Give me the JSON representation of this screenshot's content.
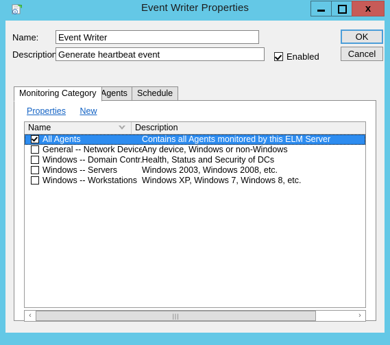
{
  "window": {
    "title": "Event Writer Properties",
    "icon": "event-writer-icon",
    "minimize_label": "—",
    "maximize_label": "□",
    "close_label": "x"
  },
  "form": {
    "name_label": "Name:",
    "name_value": "Event Writer",
    "name_placeholder": "",
    "description_label": "Description",
    "description_value": "Generate heartbeat event",
    "description_placeholder": "",
    "enabled_label": "Enabled",
    "enabled_checked": true
  },
  "buttons": {
    "ok_label": "OK",
    "cancel_label": "Cancel"
  },
  "tabs": [
    {
      "label": "Monitoring Category",
      "active": true
    },
    {
      "label": "Agents",
      "active": false
    },
    {
      "label": "Schedule",
      "active": false
    }
  ],
  "toolbar_links": [
    {
      "label": "Properties"
    },
    {
      "label": "New"
    }
  ],
  "list": {
    "columns": [
      {
        "label": "Name",
        "sorted": true,
        "sort_direction": "descending"
      },
      {
        "label": "Description",
        "sorted": false
      }
    ],
    "rows": [
      {
        "checked": true,
        "selected": true,
        "name": "All Agents",
        "description": "Contains all Agents monitored by this ELM Server"
      },
      {
        "checked": false,
        "selected": false,
        "name": "General -- Network Devices",
        "description": "Any device, Windows or non-Windows"
      },
      {
        "checked": false,
        "selected": false,
        "name": "Windows -- Domain Contr...",
        "description": "Health, Status and Security of DCs"
      },
      {
        "checked": false,
        "selected": false,
        "name": "Windows -- Servers",
        "description": "Windows 2003, Windows 2008, etc."
      },
      {
        "checked": false,
        "selected": false,
        "name": "Windows -- Workstations",
        "description": "Windows XP, Windows 7, Windows 8, etc."
      }
    ]
  },
  "scrollbar": {
    "left_arrow": "‹",
    "right_arrow": "›",
    "grip": "|||"
  },
  "colors": {
    "title_bar": "#64c8e6",
    "close_button": "#c75b58",
    "selection": "#2d8cf0",
    "link": "#1262c4",
    "dialog_face": "#f0f0f0",
    "default_button_focus": "#4c9ed9"
  }
}
